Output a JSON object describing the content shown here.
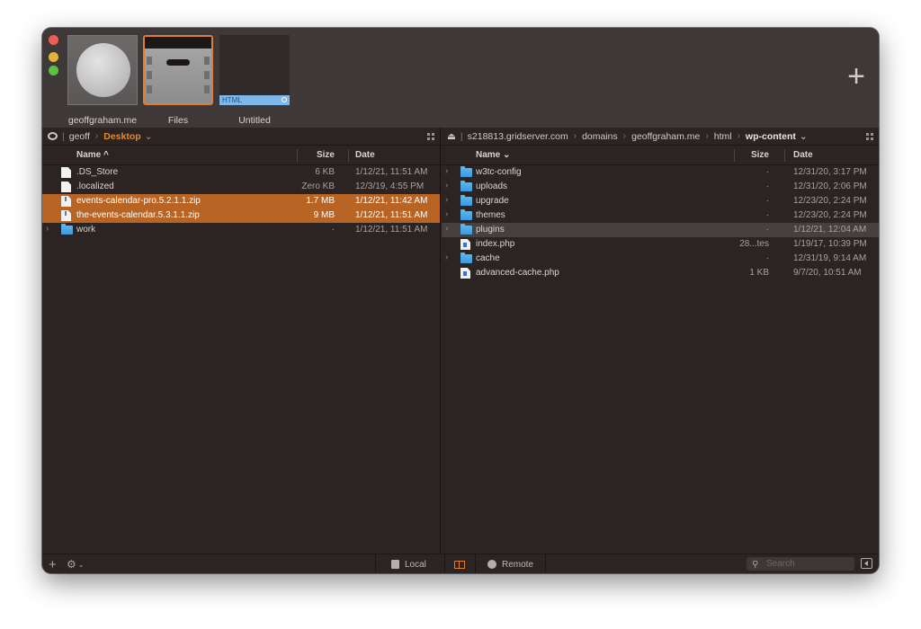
{
  "tabs": [
    {
      "label": "geoffgraham.me",
      "icon": "globe-icon"
    },
    {
      "label": "Files",
      "icon": "filmstrip-icon",
      "active": true
    },
    {
      "label": "Untitled",
      "badge": "HTML"
    }
  ],
  "new_tab_icon": "+",
  "left": {
    "path": [
      {
        "label": "geoff"
      },
      {
        "label": "Desktop",
        "current": true
      }
    ],
    "path_toggle_icon": "eye-icon",
    "dropdown_icon": "⌄",
    "columns": {
      "name": "Name ^",
      "size": "Size",
      "date": "Date"
    },
    "rows": [
      {
        "name": ".DS_Store",
        "type": "doc",
        "size": "6 KB",
        "date": "1/12/21, 11:51 AM"
      },
      {
        "name": ".localized",
        "type": "doc",
        "size": "Zero KB",
        "date": "12/3/19, 4:55 PM"
      },
      {
        "name": "events-calendar-pro.5.2.1.1.zip",
        "type": "zip",
        "size": "1.7 MB",
        "date": "1/12/21, 11:42 AM",
        "selected": true
      },
      {
        "name": "the-events-calendar.5.3.1.1.zip",
        "type": "zip",
        "size": "9 MB",
        "date": "1/12/21, 11:51 AM",
        "selected": true
      },
      {
        "name": "work",
        "type": "folder",
        "size": "·",
        "date": "1/12/21, 11:51 AM",
        "expandable": true
      }
    ]
  },
  "right": {
    "path": [
      {
        "label": "s218813.gridserver.com"
      },
      {
        "label": "domains"
      },
      {
        "label": "geoffgraham.me"
      },
      {
        "label": "html"
      },
      {
        "label": "wp-content",
        "current": true
      }
    ],
    "eject_icon": "⏏",
    "dropdown_icon": "⌄",
    "columns": {
      "name": "Name ⌄",
      "size": "Size",
      "date": "Date"
    },
    "rows": [
      {
        "name": "w3tc-config",
        "type": "folder",
        "size": "·",
        "date": "12/31/20, 3:17 PM",
        "expandable": true
      },
      {
        "name": "uploads",
        "type": "folder",
        "size": "·",
        "date": "12/31/20, 2:06 PM",
        "expandable": true
      },
      {
        "name": "upgrade",
        "type": "folder",
        "size": "·",
        "date": "12/23/20, 2:24 PM",
        "expandable": true
      },
      {
        "name": "themes",
        "type": "folder",
        "size": "·",
        "date": "12/23/20, 2:24 PM",
        "expandable": true
      },
      {
        "name": "plugins",
        "type": "folder",
        "size": "·",
        "date": "1/12/21, 12:04 AM",
        "expandable": true,
        "highlighted": true
      },
      {
        "name": "index.php",
        "type": "php",
        "size": "28...tes",
        "date": "1/19/17, 10:39 PM"
      },
      {
        "name": "cache",
        "type": "folder",
        "size": "·",
        "date": "12/31/19, 9:14 AM",
        "expandable": true
      },
      {
        "name": "advanced-cache.php",
        "type": "php",
        "size": "1 KB",
        "date": "9/7/20, 10:51 AM"
      }
    ]
  },
  "bottombar": {
    "add_icon": "+",
    "gear_icon": "⚙",
    "local_label": "Local",
    "remote_label": "Remote",
    "search_placeholder": "Search",
    "accent": "#e07f2f"
  }
}
